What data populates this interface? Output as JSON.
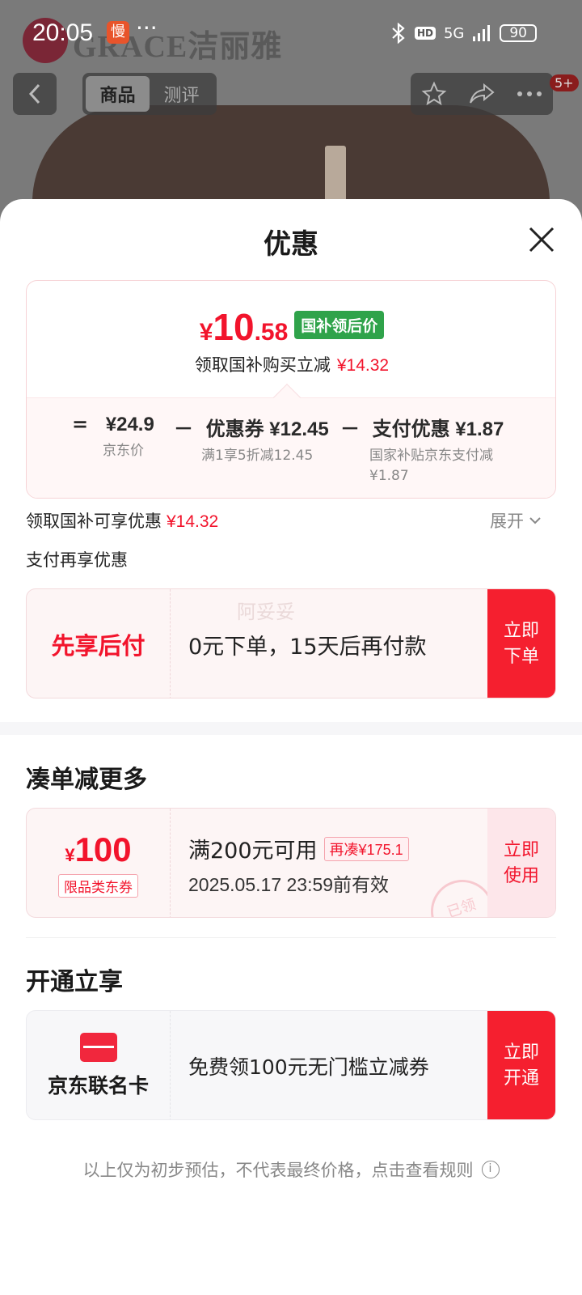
{
  "status_bar": {
    "time": "20:05",
    "app_badge": "慢",
    "network": "5G",
    "hd": "HD",
    "battery": "90"
  },
  "background": {
    "brand_text": "GRACE洁丽雅"
  },
  "nav": {
    "tabs": [
      {
        "label": "商品",
        "active": true
      },
      {
        "label": "测评",
        "active": false
      }
    ],
    "badge": "5+"
  },
  "sheet": {
    "title": "优惠",
    "price": {
      "currency": "¥",
      "integer": "10",
      "decimal": ".58",
      "tag": "国补领后价",
      "subtitle": "领取国补购买立减",
      "subtitle_amount": "¥14.32"
    },
    "formula": [
      {
        "op": "=",
        "value": "¥24.9",
        "caption": "京东价"
      },
      {
        "op": "－",
        "value": "优惠券 ¥12.45",
        "caption": "满1享5折减12.45"
      },
      {
        "op": "－",
        "value": "支付优惠 ¥1.87",
        "caption": "国家补贴京东支付减¥1.87"
      }
    ],
    "subsidy_line": {
      "label": "领取国补可享优惠",
      "amount": "¥14.32",
      "expand": "展开"
    },
    "pay_section_label": "支付再享优惠",
    "bnpl": {
      "left": "先享后付",
      "desc": "0元下单，15天后再付款",
      "watermark": "阿妥妥",
      "button": "立即下单"
    },
    "bundle": {
      "title": "凑单减更多",
      "coupon": {
        "currency": "¥",
        "amount": "100",
        "type": "限品类东券",
        "condition": "满200元可用",
        "need_more": "再凑¥175.1",
        "expiry": "2025.05.17  23:59前有效",
        "stamp": "已领",
        "button": "立即使用"
      }
    },
    "membership": {
      "title": "开通立享",
      "card_name": "京东联名卡",
      "desc": "免费领100元无门槛立减券",
      "button": "立即开通"
    },
    "footer": "以上仅为初步预估，不代表最终价格，点击查看规则"
  },
  "colors": {
    "accent_red": "#f2142c",
    "button_red": "#f51f2f",
    "tag_green": "#2fa34a"
  }
}
